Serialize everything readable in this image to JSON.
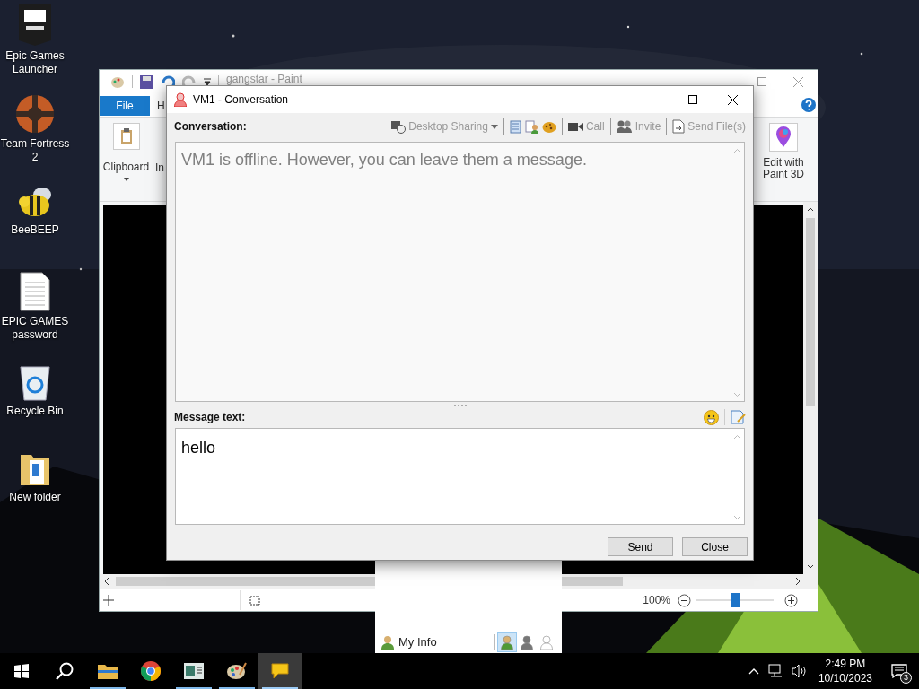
{
  "desktop_icons": [
    {
      "label": "Epic Games Launcher",
      "kind": "epic"
    },
    {
      "label": "Team Fortress 2",
      "kind": "tf2"
    },
    {
      "label": "BeeBEEP",
      "kind": "bee"
    },
    {
      "label": "EPIC GAMES password",
      "kind": "document"
    },
    {
      "label": "Recycle Bin",
      "kind": "recycle"
    },
    {
      "label": "New folder",
      "kind": "folder"
    }
  ],
  "paint_window": {
    "title": "gangstar - Paint",
    "tabs": [
      {
        "label": "File",
        "kind": "file_menu"
      },
      {
        "label": "H",
        "kind": "tab"
      }
    ],
    "ribbon_groups": [
      {
        "label": "Clipboard",
        "kind": "clipboard"
      },
      {
        "label": "In",
        "kind": "partial"
      },
      {
        "label": "Edit with Paint 3D",
        "kind": "paint3d"
      }
    ],
    "zoom": {
      "reading": "100%",
      "level": 0.5
    }
  },
  "conversation_window": {
    "title": "VM1 - Conversation",
    "conversation_label": "Conversation:",
    "toolbar": [
      {
        "label": "Desktop Sharing",
        "kind": "dropdown",
        "disabled": true
      },
      {
        "kind": "log"
      },
      {
        "kind": "info"
      },
      {
        "kind": "cookie"
      },
      {
        "label": "Call",
        "kind": "call",
        "disabled": true
      },
      {
        "label": "Invite",
        "kind": "invite",
        "disabled": true
      },
      {
        "label": "Send File(s)",
        "kind": "file",
        "disabled": true
      }
    ],
    "history_text": "VM1 is offline. However, you can leave them a message.",
    "message_label": "Message text:",
    "message_value": "hello",
    "buttons": [
      "Send",
      "Close"
    ]
  },
  "beebeep_panel": {
    "my_info": "My Info",
    "status_options": [
      {
        "kind": "online",
        "selected": true
      },
      {
        "kind": "away",
        "selected": false
      },
      {
        "kind": "offline",
        "selected": false
      }
    ]
  },
  "taskbar": {
    "apps": [
      {
        "kind": "explorer",
        "running": true,
        "active": false
      },
      {
        "kind": "chrome",
        "running": false,
        "active": false
      },
      {
        "kind": "window",
        "running": true,
        "active": false
      },
      {
        "kind": "paint",
        "running": true,
        "active": false
      },
      {
        "kind": "chat",
        "running": true,
        "active": true
      }
    ],
    "time": "2:49 PM",
    "date": "10/10/2023",
    "notifications": "3"
  }
}
